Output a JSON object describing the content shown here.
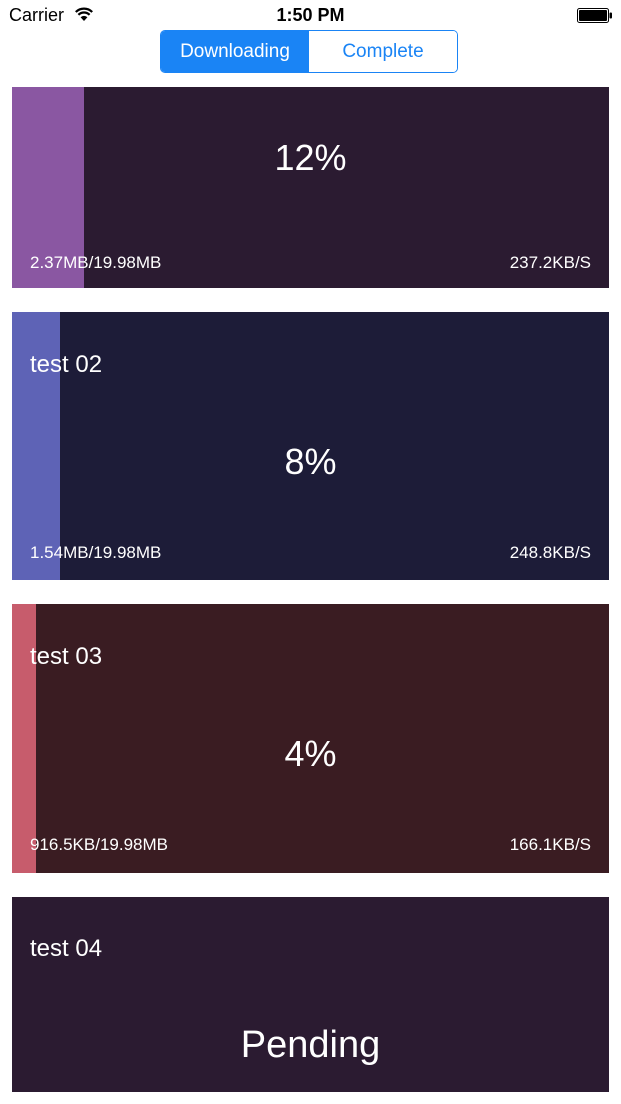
{
  "status_bar": {
    "carrier": "Carrier",
    "time": "1:50 PM"
  },
  "tabs": [
    {
      "label": "Downloading",
      "active": true
    },
    {
      "label": "Complete",
      "active": false
    }
  ],
  "downloads": [
    {
      "percent": "12%",
      "progress": 0.12,
      "size": "2.37MB/19.98MB",
      "speed": "237.2KB/S",
      "bg_color": "#2b1b31",
      "fill_color": "#8a57a2"
    },
    {
      "name": "test 02",
      "percent": "8%",
      "progress": 0.08,
      "size": "1.54MB/19.98MB",
      "speed": "248.8KB/S",
      "bg_color": "#1d1c38",
      "fill_color": "#5e63b6"
    },
    {
      "name": "test 03",
      "percent": "4%",
      "progress": 0.04,
      "size": "916.5KB/19.98MB",
      "speed": "166.1KB/S",
      "bg_color": "#3a1c22",
      "fill_color": "#c75c6c"
    },
    {
      "name": "test 04",
      "status": "Pending",
      "bg_color": "#2b1b31"
    }
  ]
}
